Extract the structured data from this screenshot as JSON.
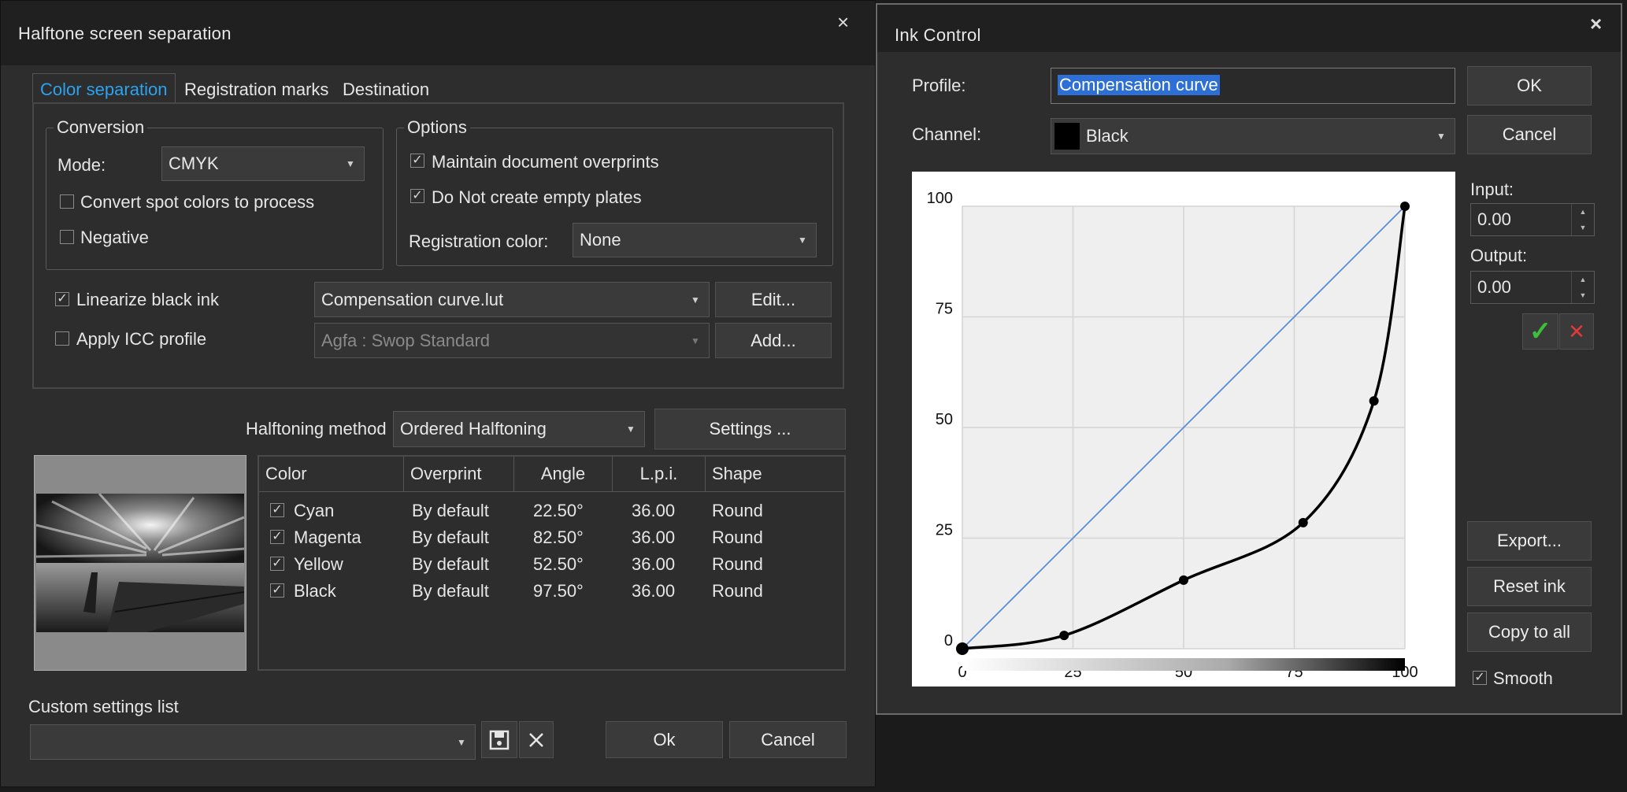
{
  "halftone": {
    "title": "Halftone screen separation",
    "close_glyph": "×",
    "tabs": [
      {
        "label": "Color separation",
        "active": true
      },
      {
        "label": "Registration marks",
        "active": false
      },
      {
        "label": "Destination",
        "active": false
      }
    ],
    "conversion": {
      "legend": "Conversion",
      "mode_label": "Mode:",
      "mode_value": "CMYK",
      "spot_label": "Convert spot colors to process",
      "spot_checked": false,
      "negative_label": "Negative",
      "negative_checked": false
    },
    "options": {
      "legend": "Options",
      "overprints_label": "Maintain document overprints",
      "overprints_checked": true,
      "empty_plates_label": "Do Not create empty plates",
      "empty_plates_checked": true,
      "registration_label": "Registration color:",
      "registration_value": "None"
    },
    "linearize": {
      "label": "Linearize black ink",
      "checked": true,
      "value": "Compensation curve.lut",
      "button": "Edit..."
    },
    "icc": {
      "label": "Apply ICC profile",
      "checked": false,
      "value": "Agfa : Swop Standard",
      "button": "Add..."
    },
    "halftoning": {
      "label": "Halftoning method",
      "value": "Ordered Halftoning",
      "settings_button": "Settings ..."
    },
    "table": {
      "headers": [
        "Color",
        "Overprint",
        "Angle",
        "L.p.i.",
        "Shape"
      ],
      "rows": [
        {
          "color": "Cyan",
          "overprint": "By default",
          "angle": "22.50°",
          "lpi": "36.00",
          "shape": "Round",
          "checked": true
        },
        {
          "color": "Magenta",
          "overprint": "By default",
          "angle": "82.50°",
          "lpi": "36.00",
          "shape": "Round",
          "checked": true
        },
        {
          "color": "Yellow",
          "overprint": "By default",
          "angle": "52.50°",
          "lpi": "36.00",
          "shape": "Round",
          "checked": true
        },
        {
          "color": "Black",
          "overprint": "By default",
          "angle": "97.50°",
          "lpi": "36.00",
          "shape": "Round",
          "checked": true
        }
      ]
    },
    "custom_settings_label": "Custom settings list",
    "custom_settings_value": "",
    "ok_button": "Ok",
    "cancel_button": "Cancel"
  },
  "ink": {
    "title": "Ink Control",
    "close_glyph": "×",
    "profile_label": "Profile:",
    "profile_value": "Compensation curve",
    "channel_label": "Channel:",
    "channel_value": "Black",
    "channel_swatch": "#000000",
    "ok_button": "OK",
    "cancel_button": "Cancel",
    "input_label": "Input:",
    "input_value": "0.00",
    "output_label": "Output:",
    "output_value": "0.00",
    "accept_glyph": "✓",
    "reject_glyph": "✕",
    "export_button": "Export...",
    "reset_button": "Reset ink",
    "copy_button": "Copy to all",
    "smooth_label": "Smooth",
    "smooth_checked": true
  },
  "chart_data": {
    "type": "line",
    "title": "",
    "xlabel": "",
    "ylabel": "",
    "xlim": [
      0,
      100
    ],
    "ylim": [
      0,
      100
    ],
    "x_ticks": [
      "0",
      "25",
      "50",
      "75",
      "100"
    ],
    "y_ticks": [
      "0",
      "25",
      "50",
      "75",
      "100"
    ],
    "grid": true,
    "series": [
      {
        "x": [
          0,
          100
        ],
        "y": [
          0,
          100
        ],
        "color": "#5b8bd8"
      },
      {
        "x": [
          0,
          23,
          50,
          77,
          93,
          100
        ],
        "y": [
          0,
          3,
          15.5,
          28.5,
          56,
          100
        ],
        "color": "#000000",
        "markers": true,
        "smooth": true
      }
    ],
    "colors": {
      "accent": "#1aa3ff",
      "check_ok": "#3cc03c",
      "reject": "#e23a3a"
    }
  }
}
